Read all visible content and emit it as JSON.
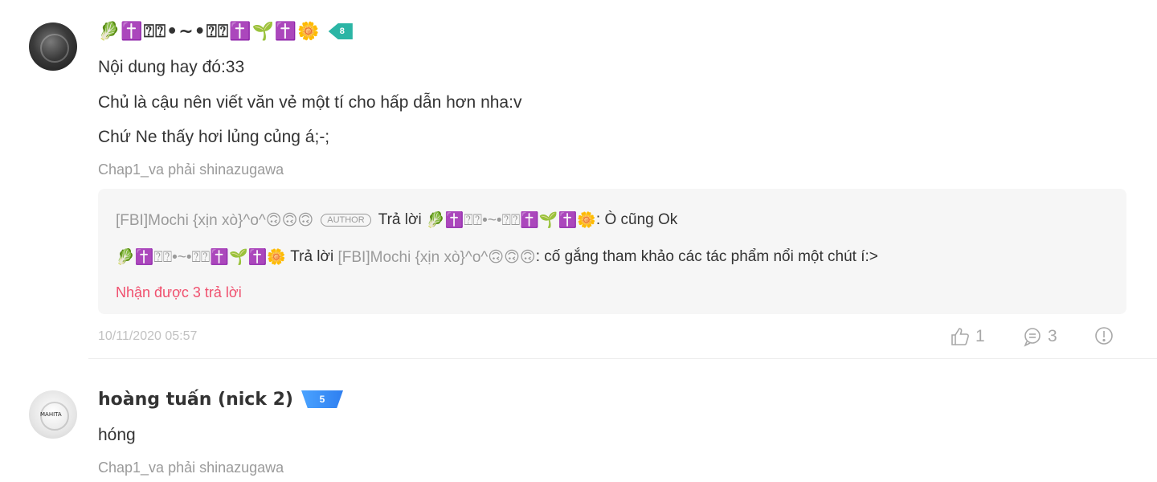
{
  "comments": [
    {
      "username": "🥬✝️⍰⍰•~•⍰⍰✝️🌱✝️🌼",
      "badge": "8",
      "lines": [
        "Nội dung hay đó:33",
        "Chủ là cậu nên viết văn vẻ một tí cho hấp dẫn hơn nha:v",
        "Chứ Ne thấy hơi lủng củng á;-;"
      ],
      "source": "Chap1_va phải shinazugawa",
      "replies": [
        {
          "author": "[FBI]Mochi {xịn xò}^o^🙃🙃🙃",
          "author_tag": "AUTHOR",
          "verb": "Trả lời",
          "target": "🥬✝️⍰⍰•~•⍰⍰✝️🌱✝️🌼",
          "text": ": Ò cũng Ok"
        },
        {
          "author": "🥬✝️⍰⍰•~•⍰⍰✝️🌱✝️🌼",
          "verb": "Trả lời",
          "target": "[FBI]Mochi {xịn xò}^o^🙃🙃🙃",
          "text": ": cố gắng tham khảo các tác phẩm nổi một chút í:>"
        }
      ],
      "more_replies": "Nhận được 3 trả lời",
      "timestamp": "10/11/2020 05:57",
      "likes": "1",
      "reply_count": "3"
    },
    {
      "username": "hoàng tuấn (nick 2)",
      "badge": "5",
      "avatar_text": "MAHITA",
      "lines": [
        "hóng"
      ],
      "source": "Chap1_va phải shinazugawa"
    }
  ],
  "colors": {
    "accent_red": "#f0506e",
    "badge_green": "#2bb5a5",
    "badge_blue": "#2f7ff0",
    "muted": "#9a9a9a"
  },
  "icons": {
    "like": "thumbs-up-icon",
    "reply": "comment-icon",
    "report": "report-icon"
  }
}
